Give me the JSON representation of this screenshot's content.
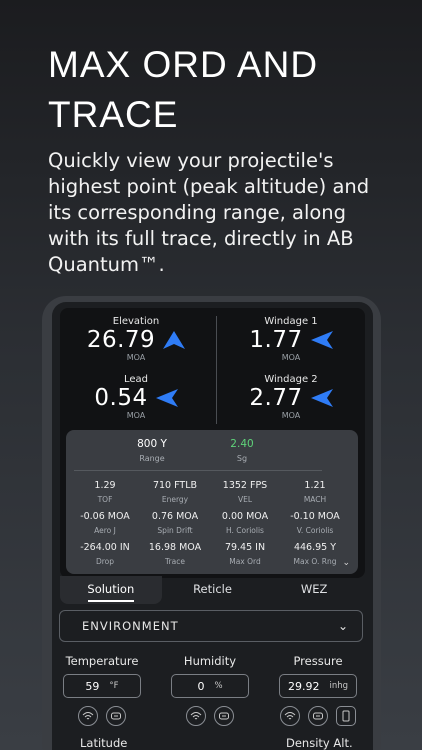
{
  "headline": "MAX ORD AND TRACE",
  "subtext": "Quickly view your projectile's highest point (peak altitude) and its corresponding range, along with its full trace, directly in AB Quantum™.",
  "colors": {
    "accent": "#2f7cf6",
    "sg": "#5fd37a"
  },
  "solution": {
    "elevation": {
      "label": "Elevation",
      "value": "26.79",
      "unit": "MOA",
      "icon": "arrow-up-icon"
    },
    "windage1": {
      "label": "Windage 1",
      "value": "1.77",
      "unit": "MOA",
      "icon": "arrow-left-icon"
    },
    "lead": {
      "label": "Lead",
      "value": "0.54",
      "unit": "MOA",
      "icon": "arrow-left-icon"
    },
    "windage2": {
      "label": "Windage 2",
      "value": "2.77",
      "unit": "MOA",
      "icon": "arrow-left-icon"
    }
  },
  "details": {
    "range": {
      "value": "800 Y",
      "label": "Range"
    },
    "sg": {
      "value": "2.40",
      "label": "Sg"
    },
    "rows": [
      [
        {
          "value": "1.29",
          "label": "TOF"
        },
        {
          "value": "710 FTLB",
          "label": "Energy"
        },
        {
          "value": "1352 FPS",
          "label": "VEL"
        },
        {
          "value": "1.21",
          "label": "MACH"
        }
      ],
      [
        {
          "value": "-0.06 MOA",
          "label": "Aero J"
        },
        {
          "value": "0.76 MOA",
          "label": "Spin Drift"
        },
        {
          "value": "0.00 MOA",
          "label": "H. Coriolis"
        },
        {
          "value": "-0.10 MOA",
          "label": "V. Coriolis"
        }
      ],
      [
        {
          "value": "-264.00 IN",
          "label": "Drop"
        },
        {
          "value": "16.98 MOA",
          "label": "Trace"
        },
        {
          "value": "79.45 IN",
          "label": "Max Ord"
        },
        {
          "value": "446.95 Y",
          "label": "Max O. Rng"
        }
      ]
    ]
  },
  "tabs": [
    {
      "label": "Solution"
    },
    {
      "label": "Reticle"
    },
    {
      "label": "WEZ"
    }
  ],
  "environment": {
    "label": "ENVIRONMENT"
  },
  "params": {
    "temperature": {
      "label": "Temperature",
      "value": "59",
      "unit": "°F"
    },
    "humidity": {
      "label": "Humidity",
      "value": "0",
      "unit": "%"
    },
    "pressure": {
      "label": "Pressure",
      "value": "29.92",
      "unit": "inhg"
    }
  },
  "bottom": {
    "latitude": "Latitude",
    "density_alt": "Density Alt."
  }
}
